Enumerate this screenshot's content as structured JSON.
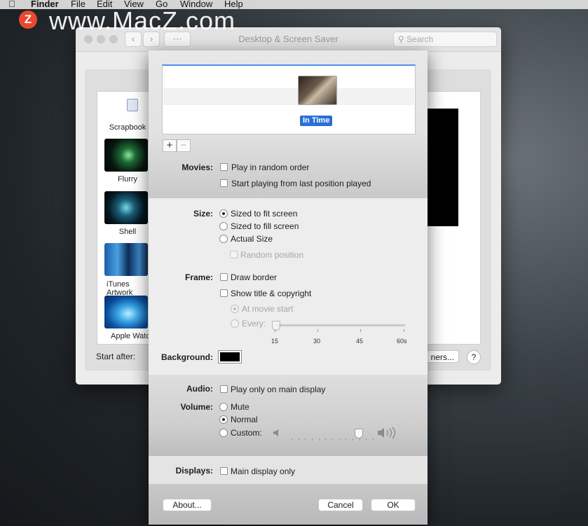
{
  "menubar": {
    "apple": "",
    "app": "Finder",
    "items": [
      "File",
      "Edit",
      "View",
      "Go",
      "Window",
      "Help"
    ]
  },
  "watermark": {
    "badge": "Z",
    "text": "www.MacZ.com"
  },
  "window": {
    "title": "Desktop & Screen Saver",
    "search_placeholder": "Search",
    "screensavers": [
      "Scrapbook",
      "Flurry",
      "Shell",
      "iTunes Artwork",
      "Apple Watch"
    ],
    "start_after_label": "Start after:",
    "options_button": "ners...",
    "help_button": "?"
  },
  "sheet": {
    "movie_item": "In Time",
    "add_label": "+",
    "remove_label": "−",
    "movies": {
      "label": "Movies:",
      "opt1": "Play in random order",
      "opt2": "Start playing from last position played"
    },
    "size": {
      "label": "Size:",
      "opt1": "Sized to fit screen",
      "opt2": "Sized to fill screen",
      "opt3": "Actual Size",
      "opt4": "Random position"
    },
    "frame": {
      "label": "Frame:",
      "opt1": "Draw border",
      "opt2": "Show title & copyright",
      "opt3": "At movie start",
      "opt4": "Every:"
    },
    "every_slider": {
      "ticks": [
        "15",
        "30",
        "45",
        "60s"
      ],
      "value": 15
    },
    "background": {
      "label": "Background:",
      "color": "#000000"
    },
    "audio": {
      "label": "Audio:",
      "opt1": "Play only on main display"
    },
    "volume": {
      "label": "Volume:",
      "opt1": "Mute",
      "opt2": "Normal",
      "opt3": "Custom:",
      "level": 0.82
    },
    "displays": {
      "label": "Displays:",
      "opt1": "Main display only"
    },
    "buttons": {
      "about": "About...",
      "cancel": "Cancel",
      "ok": "OK"
    }
  },
  "colors": {
    "accent": "#2a6fd8",
    "watermark_badge": "#e8492f"
  }
}
